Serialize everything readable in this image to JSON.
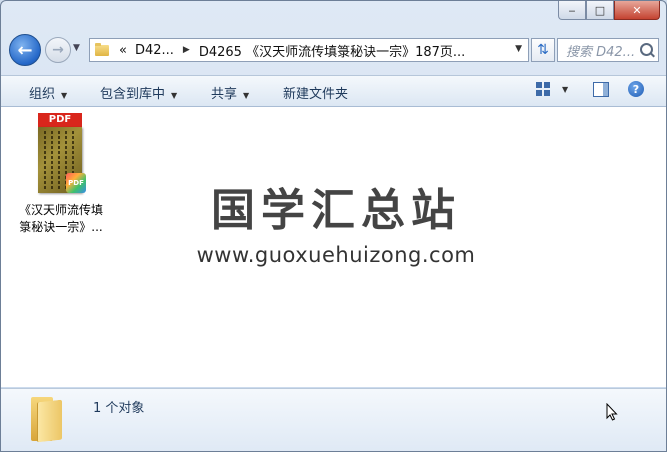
{
  "window": {
    "caption": {
      "minimize": "‒",
      "maximize": "□",
      "close": "✕"
    }
  },
  "nav": {
    "back": "←",
    "forward": "→",
    "breadcrumb": {
      "overflow": "«",
      "items": [
        "D42...",
        "D4265 《汉天师流传填箓秘诀一宗》187页..."
      ]
    },
    "search_placeholder": "搜索 D42..."
  },
  "toolbar": {
    "organize": "组织",
    "include_in_library": "包含到库中",
    "share": "共享",
    "new_folder": "新建文件夹",
    "help": "?"
  },
  "files": [
    {
      "type": "PDF",
      "name_line1": "《汉天师流传填",
      "name_line2": "箓秘诀一宗》..."
    }
  ],
  "watermark": {
    "logo": "国学汇总站",
    "url": "www.guoxuehuizong.com"
  },
  "details": {
    "count": "1 个对象"
  }
}
